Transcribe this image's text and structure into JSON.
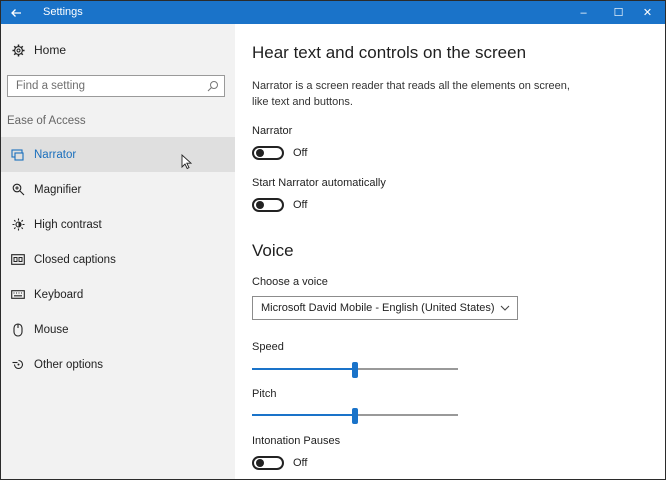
{
  "window": {
    "title": "Settings",
    "controls": {
      "minimize": "–",
      "maximize": "☐",
      "close": "✕"
    }
  },
  "sidebar": {
    "home": "Home",
    "search": {
      "placeholder": "Find a setting"
    },
    "section": "Ease of Access",
    "items": [
      {
        "label": "Narrator",
        "icon": "narrator-icon",
        "active": true
      },
      {
        "label": "Magnifier",
        "icon": "magnifier-icon",
        "active": false
      },
      {
        "label": "High contrast",
        "icon": "high-contrast-icon",
        "active": false
      },
      {
        "label": "Closed captions",
        "icon": "closed-captions-icon",
        "active": false
      },
      {
        "label": "Keyboard",
        "icon": "keyboard-icon",
        "active": false
      },
      {
        "label": "Mouse",
        "icon": "mouse-icon",
        "active": false
      },
      {
        "label": "Other options",
        "icon": "other-options-icon",
        "active": false
      }
    ]
  },
  "main": {
    "heading": "Hear text and controls on the screen",
    "description": "Narrator is a screen reader that reads all the elements on screen, like text and buttons.",
    "narrator": {
      "label": "Narrator",
      "state": "Off"
    },
    "auto_start": {
      "label": "Start Narrator automatically",
      "state": "Off"
    },
    "voice_heading": "Voice",
    "choose_voice": {
      "label": "Choose a voice",
      "value": "Microsoft David Mobile - English (United States)"
    },
    "speed": {
      "label": "Speed",
      "level": 0.5
    },
    "pitch": {
      "label": "Pitch",
      "level": 0.5
    },
    "intonation": {
      "label": "Intonation Pauses",
      "state": "Off"
    }
  },
  "colors": {
    "accent": "#1a73c9",
    "sidebar_bg": "#f2f2f2",
    "active_item_bg": "#dfdfdf"
  }
}
